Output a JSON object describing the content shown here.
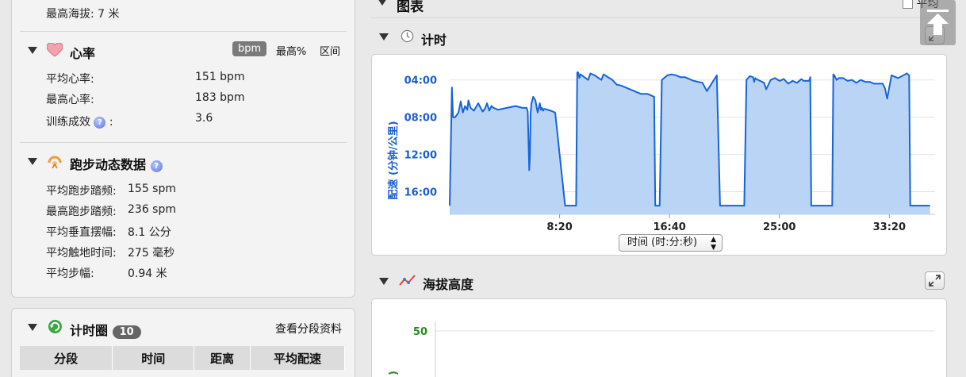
{
  "summary": {
    "max_elevation_label": "最高海拔:",
    "max_elevation_value": "7 米"
  },
  "heart_rate": {
    "title": "心率",
    "units": [
      "bpm",
      "最高%",
      "区间"
    ],
    "rows": [
      {
        "label": "平均心率:",
        "value": "151 bpm"
      },
      {
        "label": "最高心率:",
        "value": "183 bpm"
      },
      {
        "label": "训练成效",
        "suffix": ":",
        "value": "3.6"
      }
    ]
  },
  "dynamics": {
    "title": "跑步动态数据",
    "rows": [
      {
        "label": "平均跑步踏频:",
        "value": "155 spm"
      },
      {
        "label": "最高跑步踏频:",
        "value": "236 spm"
      },
      {
        "label": "平均垂直摆幅:",
        "value": "8.1 公分"
      },
      {
        "label": "平均触地时间:",
        "value": "275 毫秒"
      },
      {
        "label": "平均步幅:",
        "value": "0.94 米"
      }
    ]
  },
  "laps": {
    "title": "计时圈",
    "count": "10",
    "link": "查看分段资料",
    "columns": [
      "分段",
      "时间",
      "距离",
      "平均配速"
    ]
  },
  "charts_header": {
    "title": "图表",
    "avg_label": "平均"
  },
  "timing_chart": {
    "title": "计时",
    "axis_selector": "时间 (时:分:秒)"
  },
  "elevation_chart": {
    "title": "海拔高度"
  },
  "colors": {
    "pace_line": "#1565d8",
    "pace_fill": "#b9d4f4",
    "pace_axis": "#1a5fd0",
    "elev_axis": "#2b8a1e"
  },
  "chart_data": [
    {
      "type": "area",
      "title": "",
      "xlabel": "",
      "ylabel": "配速 (分钟/公里)",
      "y_inverted": true,
      "yticks": [
        "04:00",
        "08:00",
        "12:00",
        "16:00"
      ],
      "ylim_minutes": [
        3,
        18
      ],
      "xticks": [
        "8:20",
        "16:40",
        "25:00",
        "33:20"
      ],
      "xlim_seconds": [
        0,
        2190
      ],
      "grid": true,
      "series": [
        {
          "x": [
            0,
            10,
            15,
            25,
            40,
            50,
            60,
            70,
            80,
            85,
            95,
            110,
            130,
            150,
            160,
            170,
            180,
            190,
            200,
            220,
            260,
            300,
            330,
            350,
            355,
            360,
            362,
            365,
            368,
            372,
            380,
            390,
            400,
            410,
            415,
            420,
            425,
            430,
            460,
            480,
            525,
            540,
            545,
            560,
            575,
            580,
            585,
            590,
            595,
            630,
            640,
            660,
            690,
            700,
            740,
            760,
            780,
            810,
            840,
            870,
            900,
            930,
            935,
            940,
            943,
            945,
            950,
            955,
            965,
            980,
            990,
            1010,
            1030,
            1050,
            1070,
            1090,
            1110,
            1150,
            1170,
            1215,
            1230,
            1240,
            1243,
            1245,
            1250,
            1260,
            1290,
            1330,
            1340,
            1350,
            1365,
            1380,
            1385,
            1390,
            1395,
            1430,
            1440,
            1460,
            1480,
            1500,
            1520,
            1540,
            1560,
            1580,
            1600,
            1610,
            1635,
            1640,
            1645,
            1650,
            1700,
            1740,
            1745,
            1750,
            1760,
            1770,
            1790,
            1810,
            1830,
            1850,
            1870,
            1890,
            1910,
            1930,
            1970,
            1980,
            1990,
            2010,
            2040,
            2080,
            2090,
            2095,
            2100,
            2110,
            2115,
            2120,
            2125,
            2130,
            2140,
            2150,
            2160,
            2170,
            2175,
            2185
          ],
          "y_minutes": [
            17.5,
            4.8,
            8.0,
            8.0,
            7.5,
            6.3,
            7.5,
            6.8,
            7.2,
            6.2,
            7.0,
            7.3,
            6.5,
            7.4,
            7.1,
            6.5,
            7.3,
            6.8,
            7.0,
            7.2,
            7.0,
            6.8,
            7.0,
            7.0,
            7.4,
            12.0,
            13.7,
            12.0,
            7.6,
            6.5,
            5.8,
            6.2,
            7.5,
            6.5,
            7.2,
            7.0,
            7.3,
            7.1,
            7.3,
            7.5,
            17.5,
            17.5,
            17.5,
            17.5,
            17.5,
            3.2,
            3.2,
            3.8,
            3.4,
            4.0,
            3.3,
            3.5,
            4.0,
            3.4,
            4.0,
            4.5,
            4.6,
            4.9,
            5.2,
            5.5,
            5.5,
            5.8,
            17.5,
            17.5,
            17.5,
            17.5,
            17.5,
            17.5,
            4.0,
            3.7,
            3.5,
            3.4,
            3.5,
            3.7,
            3.7,
            3.9,
            4.1,
            4.3,
            5.2,
            3.5,
            17.5,
            17.5,
            17.5,
            17.5,
            17.5,
            17.5,
            17.5,
            17.5,
            17.5,
            4.0,
            3.6,
            3.7,
            4.2,
            3.8,
            3.9,
            4.3,
            5.0,
            4.0,
            3.8,
            4.1,
            3.9,
            4.4,
            4.1,
            4.3,
            3.9,
            4.1,
            4.1,
            3.7,
            17.5,
            17.5,
            17.5,
            17.5,
            3.4,
            3.5,
            4.0,
            3.8,
            3.8,
            4.1,
            4.0,
            4.3,
            4.0,
            4.2,
            4.2,
            4.4,
            4.4,
            4.9,
            6.0,
            3.5,
            3.8,
            3.3,
            3.5,
            17.5,
            17.5,
            17.5,
            17.5,
            17.5,
            17.5,
            17.5,
            17.5,
            17.5,
            17.5,
            17.5,
            17.5,
            17.5,
            17.5,
            17.5
          ]
        }
      ]
    },
    {
      "type": "line",
      "title": "",
      "ylabel": "",
      "yticks": [
        "50"
      ],
      "grid": true,
      "series": []
    }
  ]
}
